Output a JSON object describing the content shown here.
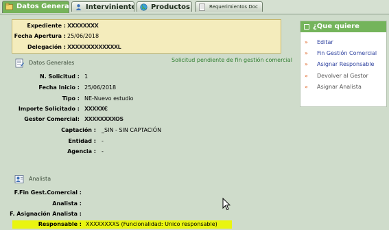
{
  "tabs": [
    {
      "label": "Datos Generales",
      "icon": "folder-icon"
    },
    {
      "label": "Intervinientes",
      "icon": "people-icon"
    },
    {
      "label": "Productos",
      "icon": "globe-icon"
    },
    {
      "label": "Requerimientos Doc",
      "icon": "document-icon"
    }
  ],
  "header": {
    "expediente_label": "Expediente :",
    "expediente_value": "XXXXXXXX",
    "fecha_apertura_label": "Fecha Apertura :",
    "fecha_apertura_value": "25/06/2018",
    "delegacion_label": "Delegación :",
    "delegacion_value": "XXXXXXXXXXXXXL"
  },
  "datos": {
    "title": "Datos Generales",
    "status": "Solicitud pendiente de fin gestión comercial",
    "fields": [
      {
        "label": "N. Solicitud :",
        "value": "1"
      },
      {
        "label": "Fecha Inicio :",
        "value": "25/06/2018"
      },
      {
        "label": "Tipo :",
        "value": "NE-Nuevo estudio"
      },
      {
        "label": "Importe Solicitado :",
        "value": "XXXXX€"
      },
      {
        "label": "Gestor Comercial:",
        "value": "XXXXXXXXOS"
      },
      {
        "label": "Captación :",
        "value": "_SIN - SIN CAPTACIÓN"
      },
      {
        "label": "Entidad :",
        "value": "-"
      },
      {
        "label": "Agencia :",
        "value": "-"
      }
    ]
  },
  "analista": {
    "title": "Analista",
    "fields": [
      {
        "label": "F.Fin Gest.Comercial :",
        "value": ""
      },
      {
        "label": "Analista :",
        "value": ""
      },
      {
        "label": "F. Asignación Analista :",
        "value": ""
      }
    ],
    "responsable_label": "Responsable :",
    "responsable_value": "XXXXXXXXS (Funcionalidad: Unico responsable)"
  },
  "actions": {
    "title": "¿Que quiere hacer?",
    "items": [
      {
        "label": "Editar",
        "enabled": true
      },
      {
        "label": "Fin Gestión Comercial",
        "enabled": true
      },
      {
        "label": "Asignar Responsable",
        "enabled": true
      },
      {
        "label": "Devolver al Gestor",
        "enabled": false
      },
      {
        "label": "Asignar Analista",
        "enabled": false
      }
    ]
  },
  "colors": {
    "accent": "#76b35a",
    "link": "#2b3f9e",
    "arrow": "#e0682a",
    "status": "#2e7d2e",
    "highlight": "#e9f510"
  }
}
